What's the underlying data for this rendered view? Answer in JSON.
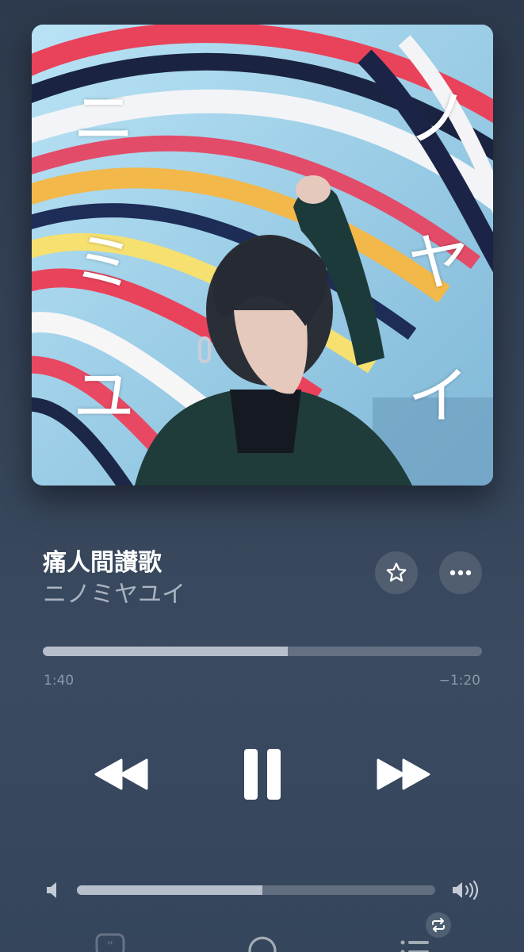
{
  "album_art": {
    "letters_left": [
      "ニ",
      "ミ",
      "ユ"
    ],
    "letters_right": [
      "ノ",
      "ヤ",
      "イ"
    ]
  },
  "track": {
    "title": "痛人間讃歌",
    "artist": "ニノミヤユイ"
  },
  "actions": {
    "favorite_icon": "star-icon",
    "more_icon": "ellipsis-icon"
  },
  "playback": {
    "elapsed": "1:40",
    "remaining": "−1:20",
    "progress_fraction": 0.558,
    "state": "playing"
  },
  "volume": {
    "level_fraction": 0.517
  },
  "bottom_bar": {
    "icons": [
      "lyrics-icon",
      "airplay-icon",
      "queue-icon",
      "repeat-icon"
    ]
  },
  "colors": {
    "background": "#344257",
    "accent_fill": "#b7bfcc",
    "secondary_text": "#aab3c1"
  }
}
